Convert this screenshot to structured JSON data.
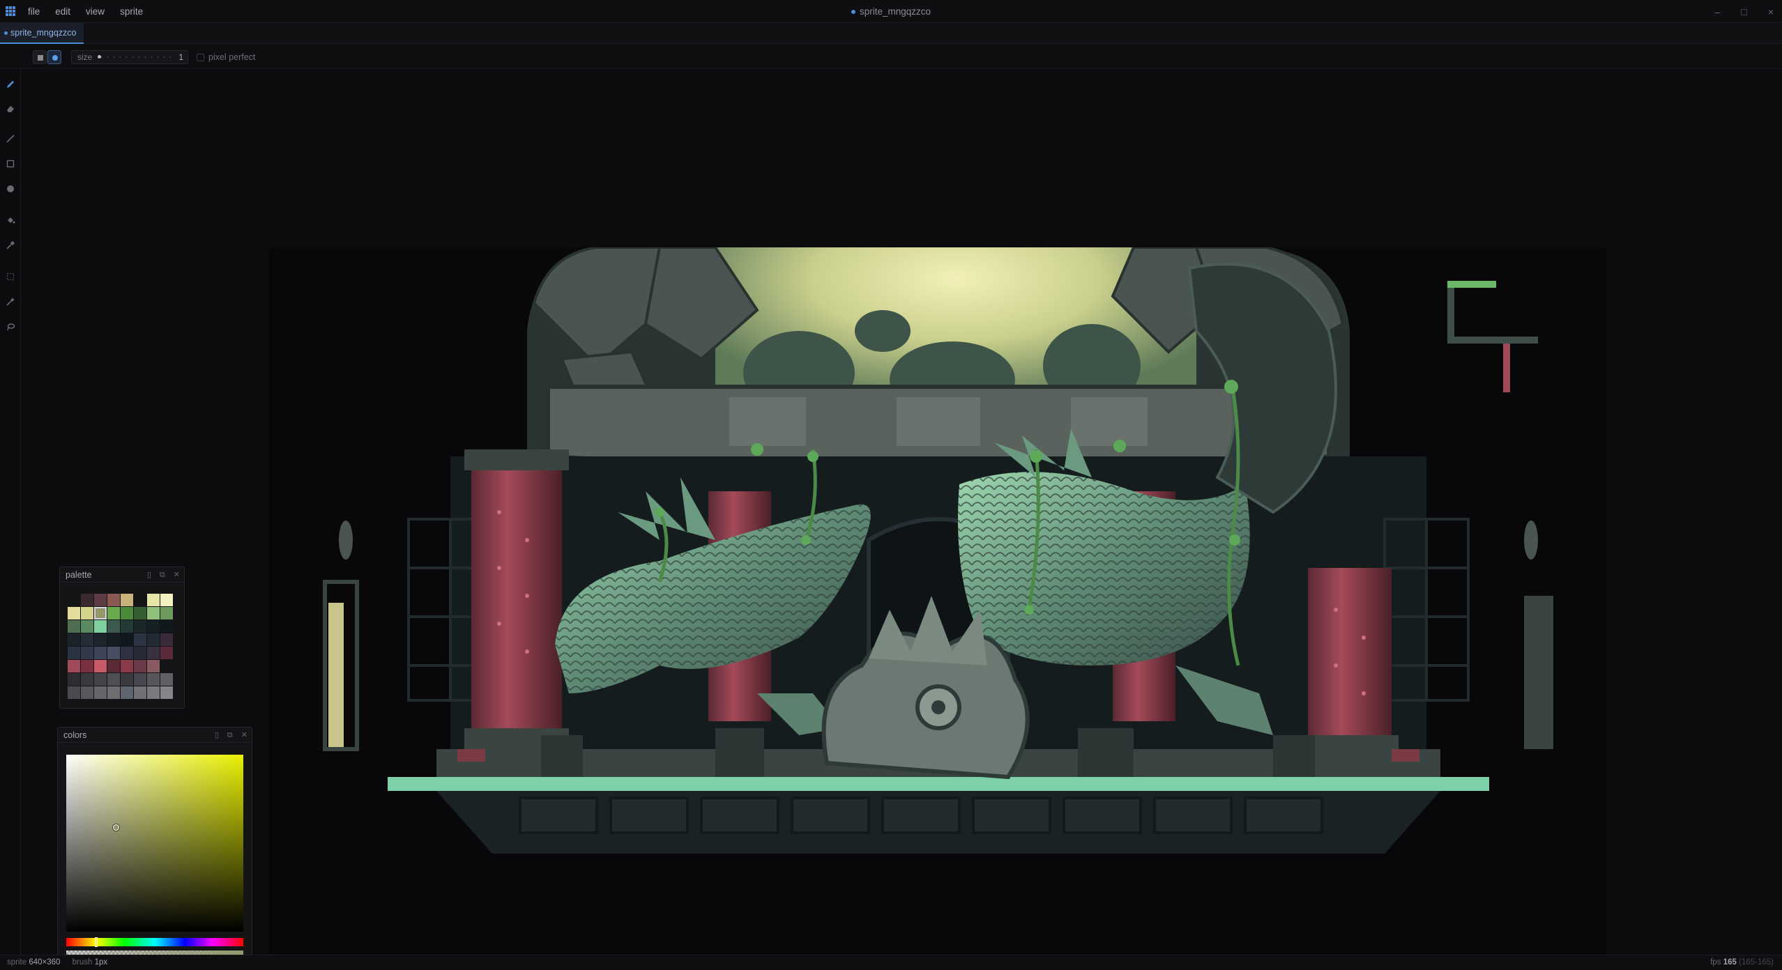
{
  "menu": {
    "items": [
      "file",
      "edit",
      "view",
      "sprite"
    ]
  },
  "window": {
    "title": "sprite_mngqzzco",
    "controls": [
      "–",
      "□",
      "×"
    ]
  },
  "tabs": [
    {
      "label": "sprite_mngqzzco",
      "active": true
    }
  ],
  "tool_options": {
    "shape_square_label": "square brush",
    "shape_circle_label": "circle brush",
    "size_label": "size",
    "size_value": "1",
    "pixel_perfect_label": "pixel perfect",
    "pixel_perfect_checked": false
  },
  "tools": [
    {
      "name": "pencil-tool",
      "active": true
    },
    {
      "name": "eraser-tool",
      "active": false
    },
    {
      "name": "line-tool",
      "active": false
    },
    {
      "name": "rectangle-tool",
      "active": false
    },
    {
      "name": "ellipse-tool",
      "active": false
    },
    {
      "name": "fill-tool",
      "active": false
    },
    {
      "name": "eyedropper-tool",
      "active": false
    },
    {
      "name": "select-tool",
      "active": false
    },
    {
      "name": "magic-wand-tool",
      "active": false
    },
    {
      "name": "lasso-tool",
      "active": false
    }
  ],
  "palette": {
    "title": "palette",
    "selected_index": 10,
    "swatches": [
      "#141417",
      "#3a2a30",
      "#5e3c44",
      "#8a5a52",
      "#c9b27a",
      "#141417",
      "#e8e5a8",
      "#f2efc0",
      "#e2de9a",
      "#d6d48c",
      "#94976c",
      "#6aa84f",
      "#4b8a3a",
      "#375e32",
      "#8fbf7a",
      "#6c9a5a",
      "#4e6e52",
      "#5a8a60",
      "#7fd0a0",
      "#3e5a50",
      "#243a38",
      "#1a2628",
      "#152024",
      "#10181c",
      "#1a222a",
      "#242e38",
      "#1c242e",
      "#161c24",
      "#121820",
      "#2a3442",
      "#222a36",
      "#3a2a3a",
      "#2a3440",
      "#34384a",
      "#3e4458",
      "#4a4e62",
      "#2e3240",
      "#262a36",
      "#3a3040",
      "#5a2a3a",
      "#a04a5a",
      "#7a3040",
      "#c85a6a",
      "#5a2a36",
      "#8a3a48",
      "#6a3a48",
      "#8a5a62",
      "#141417",
      "#2e2e32",
      "#3a3a3e",
      "#444448",
      "#505054",
      "#3a3a40",
      "#484850",
      "#56565c",
      "#606066",
      "#4a4a4e",
      "#58585c",
      "#66666a",
      "#6e6e72",
      "#5e6470",
      "#707076",
      "#7a7a7e",
      "#858589"
    ]
  },
  "colors": {
    "title": "colors",
    "hue_color": "#e8f000",
    "sv_cursor": {
      "saturation": 0.28,
      "value": 0.59
    },
    "hue_position": 0.17,
    "primary": {
      "hex": "#94976C"
    },
    "secondary": {
      "hex": "#676E67"
    }
  },
  "status": {
    "sprite_label": "sprite",
    "sprite_size": "640×360",
    "brush_label": "brush",
    "brush_size": "1px",
    "fps_label": "fps",
    "fps_value": "165",
    "fps_range": "(165-165)"
  }
}
